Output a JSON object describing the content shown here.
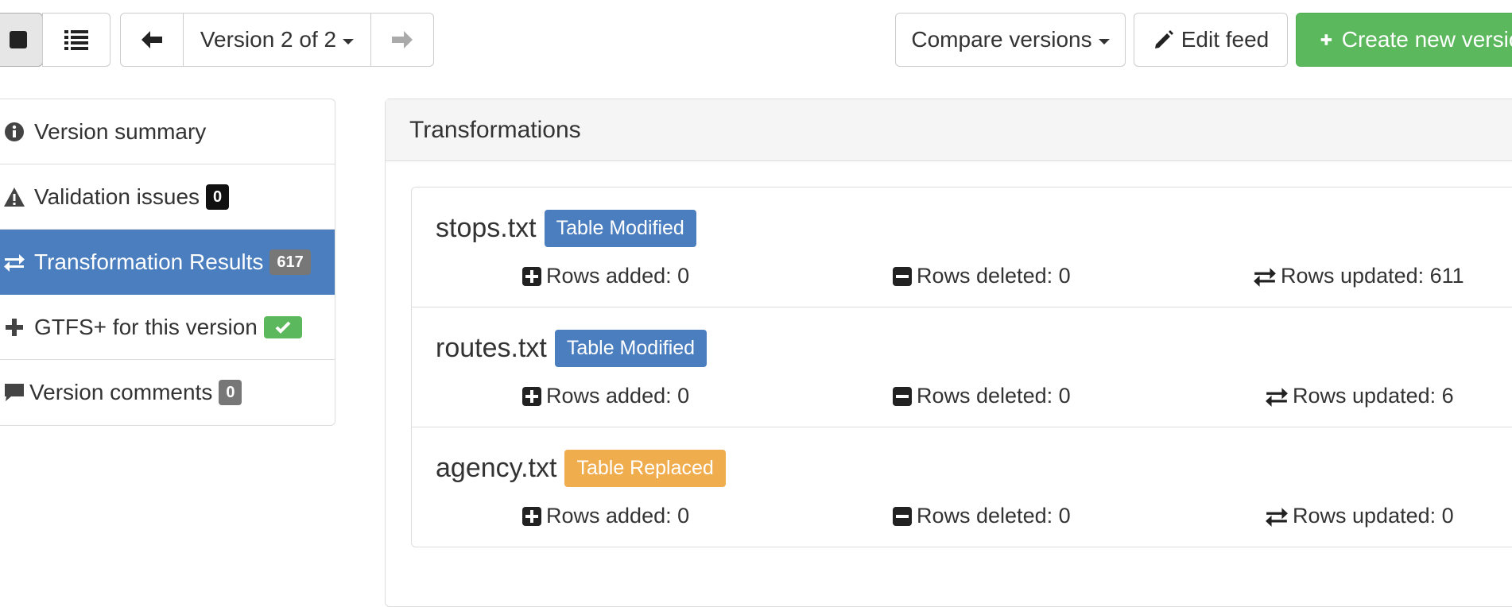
{
  "toolbar": {
    "version_label": "Version 2 of 2",
    "compare_label": "Compare versions",
    "edit_label": "Edit feed",
    "create_label": "Create new version"
  },
  "sidebar": {
    "items": [
      {
        "label": "Version summary",
        "icon": "info-circle-icon"
      },
      {
        "label": "Validation issues",
        "icon": "warning-icon",
        "badge": "0",
        "badge_color": "#111111"
      },
      {
        "label": "Transformation Results",
        "icon": "exchange-icon",
        "badge": "617",
        "badge_color": "#777777",
        "active": true
      },
      {
        "label": "GTFS+ for this version",
        "icon": "plus-icon",
        "badge_color": "#5cb85c",
        "badge_icon": "check-icon"
      },
      {
        "label": "Version comments",
        "icon": "comment-icon",
        "badge": "0",
        "badge_color": "#777777"
      }
    ]
  },
  "panel": {
    "title": "Transformations",
    "tables": [
      {
        "name": "stops.txt",
        "status": "Table Modified",
        "status_color": "#4a7ebf",
        "added": "Rows added: 0",
        "deleted": "Rows deleted: 0",
        "updated": "Rows updated: 611"
      },
      {
        "name": "routes.txt",
        "status": "Table Modified",
        "status_color": "#4a7ebf",
        "added": "Rows added: 0",
        "deleted": "Rows deleted: 0",
        "updated": "Rows updated: 6"
      },
      {
        "name": "agency.txt",
        "status": "Table Replaced",
        "status_color": "#f0ad4e",
        "added": "Rows added: 0",
        "deleted": "Rows deleted: 0",
        "updated": "Rows updated: 0"
      }
    ]
  },
  "colors": {
    "primary": "#4a7ebf",
    "success": "#5cb85c",
    "warning": "#f0ad4e"
  }
}
